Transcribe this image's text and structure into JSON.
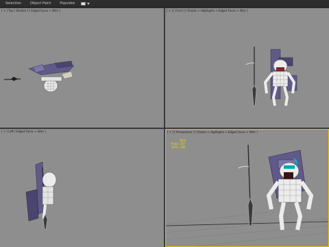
{
  "ribbon": {
    "tabs": [
      "Selection",
      "Object Paint",
      "Populate"
    ],
    "dropdown_icon": "dropdown-icon"
  },
  "viewports": {
    "top_left": {
      "label": "[ + ] Top [ Shaded ] [ Edged Faces + Wire ]"
    },
    "top_right": {
      "label": "[ + ] [ Front ] [ Ghosts + Highlights + Edged Faces + Wire ]"
    },
    "bottom_left": {
      "label": "[ + ] Left [ Edged Faces + Wire ]"
    },
    "bottom_right": {
      "label": "[ + ] [ Perspective ] [ Ghosts + Highlights + Edged Faces + Wire ]",
      "stats_total": "Total",
      "stats_polys": "Polys: 387",
      "stats_verts": "Verts: 386"
    }
  },
  "colors": {
    "viewport_bg": "#8e8e8e",
    "active_border": "#f0c000",
    "stats_text": "#e8dc00",
    "ribbon_bg": "#2d2d2d",
    "weapon_purple": "#5f5a8a",
    "body_white": "#ececec",
    "spear_dark": "#2a2a2a"
  }
}
